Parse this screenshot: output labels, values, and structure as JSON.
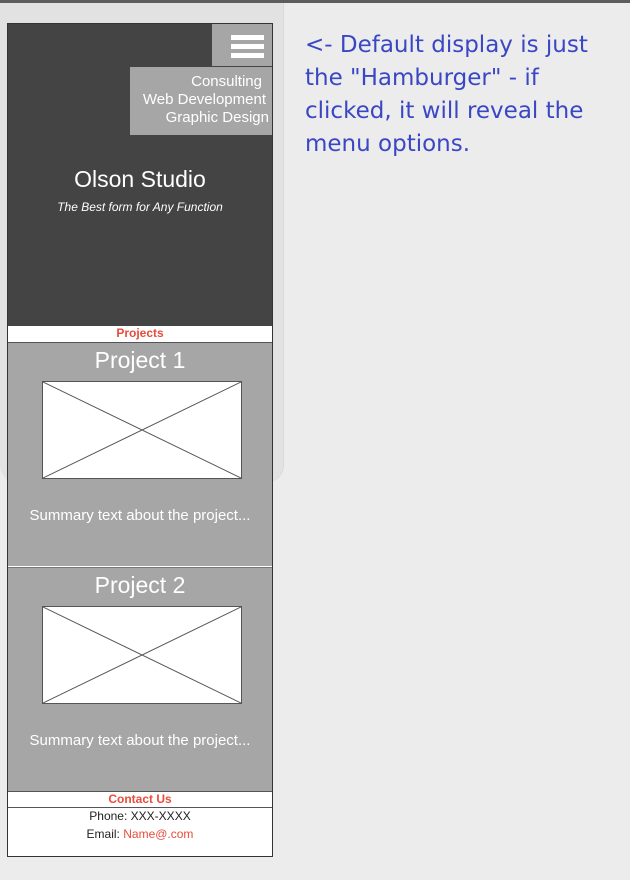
{
  "menu": {
    "items": [
      "Consulting",
      "Web Development",
      "Graphic Design"
    ]
  },
  "hero": {
    "title": "Olson Studio",
    "tagline": "The Best form for Any Function"
  },
  "projects": {
    "label": "Projects",
    "items": [
      {
        "title": "Project 1",
        "summary": "Summary text about the project..."
      },
      {
        "title": "Project 2",
        "summary": "Summary text about the project..."
      }
    ]
  },
  "contact": {
    "label": "Contact Us",
    "phone_label": "Phone:",
    "phone_value": "XXX-XXXX",
    "email_label": "Email:",
    "email_value": "Name@.com"
  },
  "annotation": {
    "text": "<- Default display is just the \"Hamburger\" - if clicked, it will reveal the menu options."
  },
  "colors": {
    "accent": "#e74c3c",
    "hero_bg": "#444444",
    "panel_bg": "#a6a6a6",
    "note_text": "#3a47c4"
  }
}
